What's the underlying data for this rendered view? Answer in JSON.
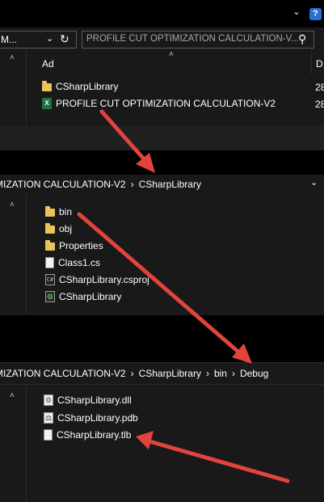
{
  "pane1": {
    "addressbar_text": "M...",
    "search_placeholder": "PROFILE CUT OPTIMIZATION CALCULATION-V...",
    "column_name": "Ad",
    "column_date": "D",
    "files": [
      {
        "name": "CSharpLibrary",
        "icon": "folder-icon",
        "date": "28"
      },
      {
        "name": "PROFILE CUT OPTIMIZATION CALCULATION-V2",
        "icon": "excel-icon",
        "date": "28"
      }
    ]
  },
  "pane2": {
    "breadcrumb": [
      "MIZATION CALCULATION-V2",
      "CSharpLibrary"
    ],
    "files": [
      {
        "name": "bin",
        "icon": "folder-icon"
      },
      {
        "name": "obj",
        "icon": "folder-icon"
      },
      {
        "name": "Properties",
        "icon": "folder-icon"
      },
      {
        "name": "Class1.cs",
        "icon": "file-icon"
      },
      {
        "name": "CSharpLibrary.csproj",
        "icon": "csproj-icon"
      },
      {
        "name": "CSharpLibrary",
        "icon": "settings-file-icon"
      }
    ]
  },
  "pane3": {
    "breadcrumb": [
      "MIZATION CALCULATION-V2",
      "CSharpLibrary",
      "bin",
      "Debug"
    ],
    "files": [
      {
        "name": "CSharpLibrary.dll",
        "icon": "dll-icon"
      },
      {
        "name": "CSharpLibrary.pdb",
        "icon": "pdb-icon"
      },
      {
        "name": "CSharpLibrary.tlb",
        "icon": "file-icon"
      }
    ]
  },
  "colors": {
    "arrow": "#e0443c",
    "folder": "#e9c559",
    "background": "#191919"
  }
}
